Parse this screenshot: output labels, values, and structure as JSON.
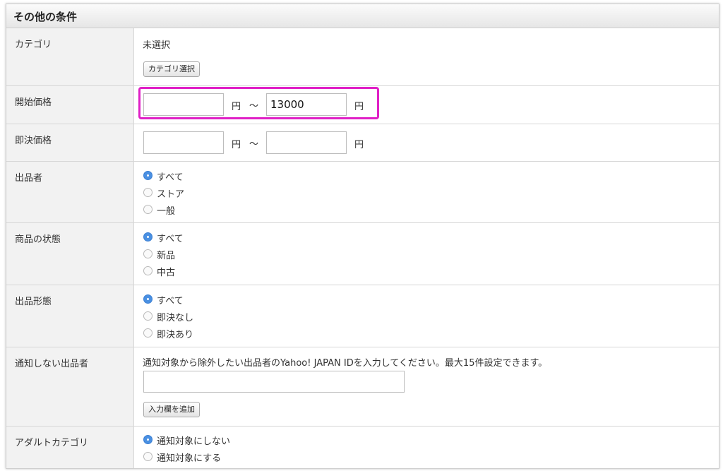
{
  "title": "その他の条件",
  "category": {
    "label": "カテゴリ",
    "value": "未選択",
    "button": "カテゴリ選択"
  },
  "start_price": {
    "label": "開始価格",
    "min_value": "",
    "unit1": "円",
    "tilde": "〜",
    "max_value": "13000",
    "unit2": "円"
  },
  "buy_now_price": {
    "label": "即決価格",
    "min_value": "",
    "unit1": "円",
    "tilde": "〜",
    "max_value": "",
    "unit2": "円"
  },
  "seller": {
    "label": "出品者",
    "options": [
      "すべて",
      "ストア",
      "一般"
    ],
    "selected_index": 0
  },
  "condition": {
    "label": "商品の状態",
    "options": [
      "すべて",
      "新品",
      "中古"
    ],
    "selected_index": 0
  },
  "listing_type": {
    "label": "出品形態",
    "options": [
      "すべて",
      "即決なし",
      "即決あり"
    ],
    "selected_index": 0
  },
  "excluded_sellers": {
    "label": "通知しない出品者",
    "description": "通知対象から除外したい出品者のYahoo! JAPAN IDを入力してください。最大15件設定できます。",
    "input_value": "",
    "button": "入力欄を追加"
  },
  "adult_category": {
    "label": "アダルトカテゴリ",
    "options": [
      "通知対象にしない",
      "通知対象にする"
    ],
    "selected_index": 0
  },
  "colors": {
    "highlight": "#e020c6",
    "radio_checked": "#4a90e2"
  }
}
